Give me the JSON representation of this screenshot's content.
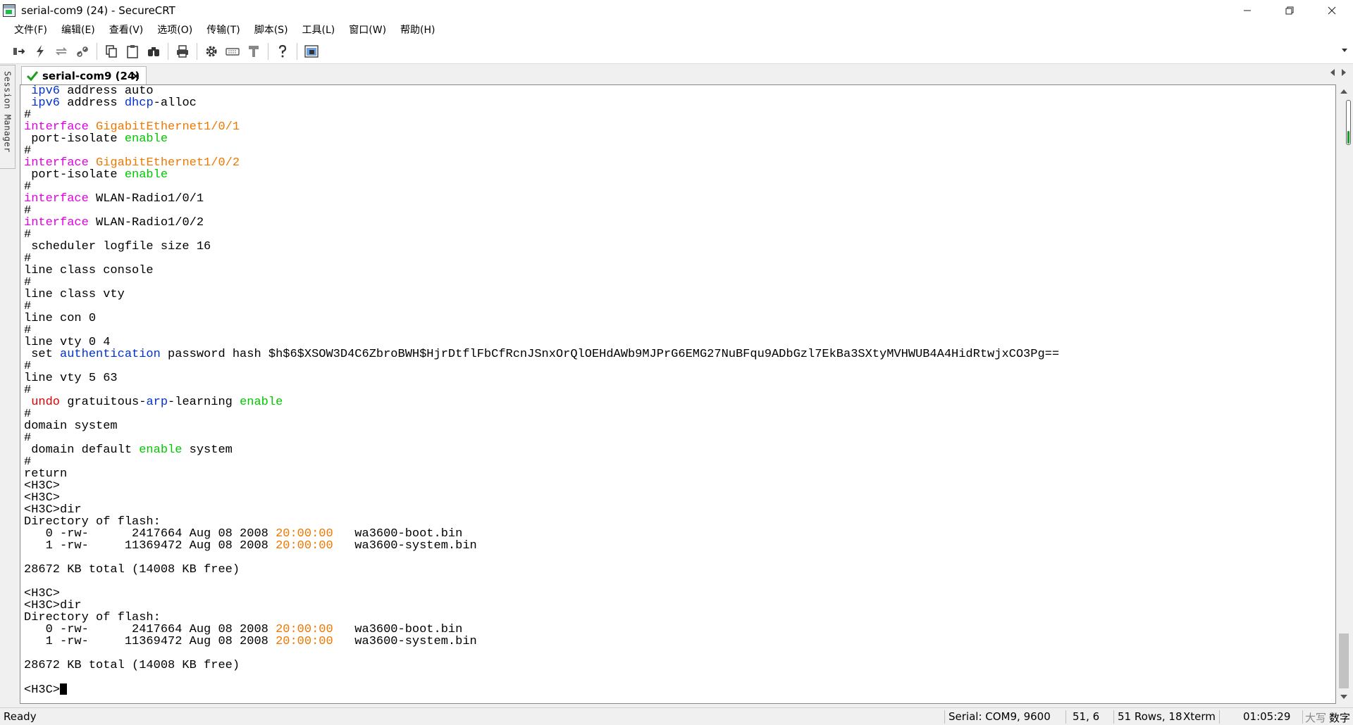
{
  "window": {
    "title": "serial-com9 (24) - SecureCRT",
    "minimize": "—",
    "close": "✕"
  },
  "menu": [
    "文件(F)",
    "编辑(E)",
    "查看(V)",
    "选项(O)",
    "传输(T)",
    "脚本(S)",
    "工具(L)",
    "窗口(W)",
    "帮助(H)"
  ],
  "toolbar": {
    "icons": [
      "connect-bar-icon",
      "quick-connect-icon",
      "reconnect-icon",
      "disconnect-icon",
      "copy-icon",
      "paste-icon",
      "find-icon",
      "print-icon",
      "session-options-icon",
      "keymap-icon",
      "sftp-icon",
      "help-icon",
      "screen-capture-icon"
    ]
  },
  "session_manager": {
    "label": "Session Manager"
  },
  "tab": {
    "label": "serial-com9 (24)",
    "close": "×",
    "status": "connected"
  },
  "terminal": {
    "lines": [
      [
        {
          "t": " "
        },
        {
          "t": "ipv6",
          "c": "blue"
        },
        {
          "t": " address auto"
        }
      ],
      [
        {
          "t": " "
        },
        {
          "t": "ipv6",
          "c": "blue"
        },
        {
          "t": " address "
        },
        {
          "t": "dhcp",
          "c": "blue"
        },
        {
          "t": "-alloc"
        }
      ],
      [
        {
          "t": "#"
        }
      ],
      [
        {
          "t": "interface",
          "c": "magenta"
        },
        {
          "t": " "
        },
        {
          "t": "GigabitEthernet1/0/1",
          "c": "orange"
        }
      ],
      [
        {
          "t": " port-isolate "
        },
        {
          "t": "enable",
          "c": "green"
        }
      ],
      [
        {
          "t": "#"
        }
      ],
      [
        {
          "t": "interface",
          "c": "magenta"
        },
        {
          "t": " "
        },
        {
          "t": "GigabitEthernet1/0/2",
          "c": "orange"
        }
      ],
      [
        {
          "t": " port-isolate "
        },
        {
          "t": "enable",
          "c": "green"
        }
      ],
      [
        {
          "t": "#"
        }
      ],
      [
        {
          "t": "interface",
          "c": "magenta"
        },
        {
          "t": " WLAN-Radio1/0/1"
        }
      ],
      [
        {
          "t": "#"
        }
      ],
      [
        {
          "t": "interface",
          "c": "magenta"
        },
        {
          "t": " WLAN-Radio1/0/2"
        }
      ],
      [
        {
          "t": "#"
        }
      ],
      [
        {
          "t": " scheduler logfile size 16"
        }
      ],
      [
        {
          "t": "#"
        }
      ],
      [
        {
          "t": "line class console"
        }
      ],
      [
        {
          "t": "#"
        }
      ],
      [
        {
          "t": "line class vty"
        }
      ],
      [
        {
          "t": "#"
        }
      ],
      [
        {
          "t": "line con 0"
        }
      ],
      [
        {
          "t": "#"
        }
      ],
      [
        {
          "t": "line vty 0 4"
        }
      ],
      [
        {
          "t": " set "
        },
        {
          "t": "authentication",
          "c": "blue"
        },
        {
          "t": " password hash $h$6$XSOW3D4C6ZbroBWH$HjrDtflFbCfRcnJSnxOrQlOEHdAWb9MJPrG6EMG27NuBFqu9ADbGzl7EkBa3SXtyMVHWUB4A4HidRtwjxCO3Pg=="
        }
      ],
      [
        {
          "t": "#"
        }
      ],
      [
        {
          "t": "line vty 5 63"
        }
      ],
      [
        {
          "t": "#"
        }
      ],
      [
        {
          "t": " "
        },
        {
          "t": "undo",
          "c": "red"
        },
        {
          "t": " gratuitous-"
        },
        {
          "t": "arp",
          "c": "blue"
        },
        {
          "t": "-learning "
        },
        {
          "t": "enable",
          "c": "green"
        }
      ],
      [
        {
          "t": "#"
        }
      ],
      [
        {
          "t": "domain system"
        }
      ],
      [
        {
          "t": "#"
        }
      ],
      [
        {
          "t": " domain default "
        },
        {
          "t": "enable",
          "c": "green"
        },
        {
          "t": " system"
        }
      ],
      [
        {
          "t": "#"
        }
      ],
      [
        {
          "t": "return"
        }
      ],
      [
        {
          "t": "<H3C>"
        }
      ],
      [
        {
          "t": "<H3C>"
        }
      ],
      [
        {
          "t": "<H3C>dir"
        }
      ],
      [
        {
          "t": "Directory of flash:"
        }
      ],
      [
        {
          "t": "   0 -rw-      2417664 Aug 08 2008 "
        },
        {
          "t": "20:00:00",
          "c": "orange"
        },
        {
          "t": "   wa3600-boot.bin"
        }
      ],
      [
        {
          "t": "   1 -rw-     11369472 Aug 08 2008 "
        },
        {
          "t": "20:00:00",
          "c": "orange"
        },
        {
          "t": "   wa3600-system.bin"
        }
      ],
      [
        {
          "t": ""
        }
      ],
      [
        {
          "t": "28672 KB total (14008 KB free)"
        }
      ],
      [
        {
          "t": ""
        }
      ],
      [
        {
          "t": "<H3C>"
        }
      ],
      [
        {
          "t": "<H3C>dir"
        }
      ],
      [
        {
          "t": "Directory of flash:"
        }
      ],
      [
        {
          "t": "   0 -rw-      2417664 Aug 08 2008 "
        },
        {
          "t": "20:00:00",
          "c": "orange"
        },
        {
          "t": "   wa3600-boot.bin"
        }
      ],
      [
        {
          "t": "   1 -rw-     11369472 Aug 08 2008 "
        },
        {
          "t": "20:00:00",
          "c": "orange"
        },
        {
          "t": "   wa3600-system.bin"
        }
      ],
      [
        {
          "t": ""
        }
      ],
      [
        {
          "t": "28672 KB total (14008 KB free)"
        }
      ],
      [
        {
          "t": ""
        }
      ],
      [
        {
          "t": "<H3C>"
        },
        {
          "t": "",
          "cursor": true
        }
      ]
    ]
  },
  "colors": {
    "magenta": "#e000e0",
    "orange": "#f07800",
    "green": "#00c800",
    "blue": "#0030d0",
    "red": "#e00000"
  },
  "status": {
    "ready": "Ready",
    "connection": "Serial: COM9, 9600",
    "cursor_pos": "51,   6",
    "size": "51 Rows, 18",
    "emulation": "Xterm",
    "time": "01:05:29",
    "caps": "大写",
    "num": "数字"
  }
}
